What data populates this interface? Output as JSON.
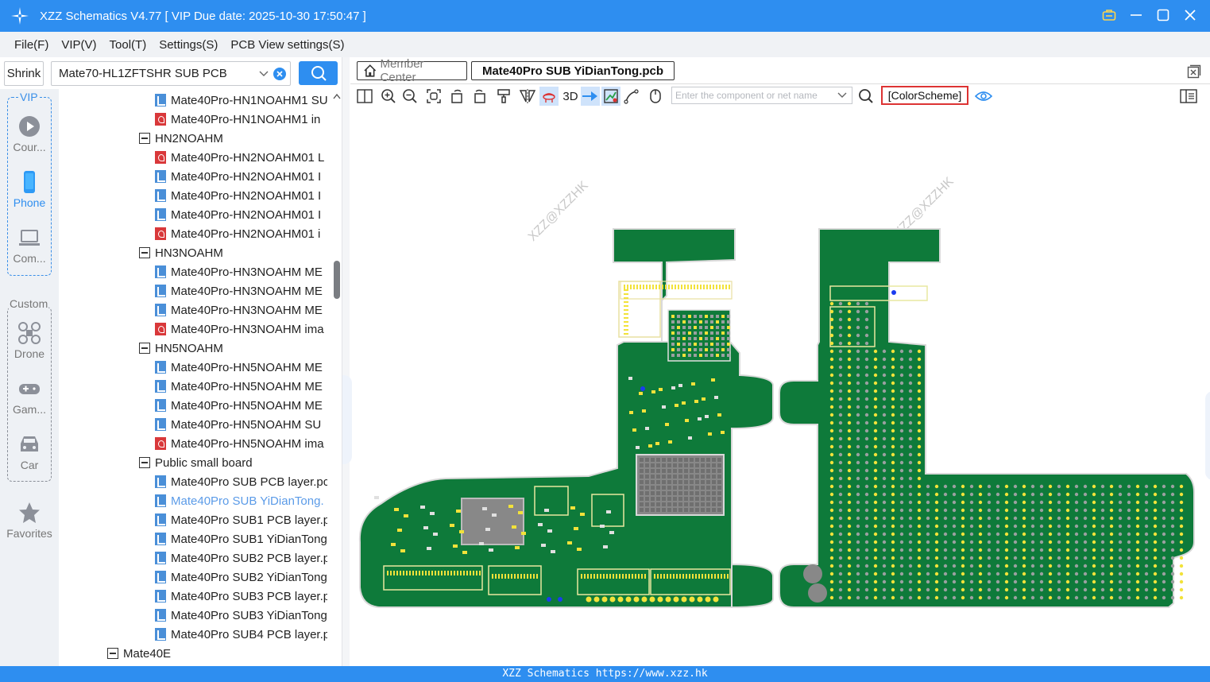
{
  "window": {
    "title": "XZZ Schematics V4.77 [ VIP Due date: 2025-10-30 17:50:47 ]"
  },
  "menu": [
    "File(F)",
    "VIP(V)",
    "Tool(T)",
    "Settings(S)",
    "PCB View settings(S)"
  ],
  "left": {
    "shrink_label": "Shrink",
    "model_value": "Mate70-HL1ZFTSHR SUB PCB",
    "categories": {
      "vip_label": "VIP",
      "custom_label": "Custom",
      "items": [
        "Cour...",
        "Phone",
        "Com...",
        "Drone",
        "Gam...",
        "Car"
      ],
      "favorites": "Favorites"
    },
    "tree": [
      {
        "type": "pcb",
        "text": "Mate40Pro-HN1NOAHM1 SU"
      },
      {
        "type": "pdf",
        "text": "Mate40Pro-HN1NOAHM1 in"
      },
      {
        "type": "group",
        "text": "HN2NOAHM"
      },
      {
        "type": "pdf",
        "text": "Mate40Pro-HN2NOAHM01 L"
      },
      {
        "type": "pcb",
        "text": "Mate40Pro-HN2NOAHM01 I"
      },
      {
        "type": "pcb",
        "text": "Mate40Pro-HN2NOAHM01 I"
      },
      {
        "type": "pcb",
        "text": "Mate40Pro-HN2NOAHM01 I"
      },
      {
        "type": "pdf",
        "text": "Mate40Pro-HN2NOAHM01 i"
      },
      {
        "type": "group",
        "text": "HN3NOAHM"
      },
      {
        "type": "pcb",
        "text": "Mate40Pro-HN3NOAHM ME"
      },
      {
        "type": "pcb",
        "text": "Mate40Pro-HN3NOAHM ME"
      },
      {
        "type": "pcb",
        "text": "Mate40Pro-HN3NOAHM ME"
      },
      {
        "type": "pdf",
        "text": "Mate40Pro-HN3NOAHM ima"
      },
      {
        "type": "group",
        "text": "HN5NOAHM"
      },
      {
        "type": "pcb",
        "text": "Mate40Pro-HN5NOAHM ME"
      },
      {
        "type": "pcb",
        "text": "Mate40Pro-HN5NOAHM ME"
      },
      {
        "type": "pcb",
        "text": "Mate40Pro-HN5NOAHM ME"
      },
      {
        "type": "pcb",
        "text": "Mate40Pro-HN5NOAHM SU"
      },
      {
        "type": "pdf",
        "text": "Mate40Pro-HN5NOAHM ima"
      },
      {
        "type": "group",
        "text": "Public small board"
      },
      {
        "type": "pcb",
        "text": "Mate40Pro SUB PCB layer.pc"
      },
      {
        "type": "pcb",
        "text": "Mate40Pro SUB YiDianTong.",
        "selected": true
      },
      {
        "type": "pcb",
        "text": "Mate40Pro SUB1 PCB layer.p"
      },
      {
        "type": "pcb",
        "text": "Mate40Pro SUB1 YiDianTong"
      },
      {
        "type": "pcb",
        "text": "Mate40Pro SUB2 PCB layer.p"
      },
      {
        "type": "pcb",
        "text": "Mate40Pro SUB2 YiDianTong"
      },
      {
        "type": "pcb",
        "text": "Mate40Pro SUB3 PCB layer.p"
      },
      {
        "type": "pcb",
        "text": "Mate40Pro SUB3 YiDianTong"
      },
      {
        "type": "pcb",
        "text": "Mate40Pro SUB4 PCB layer.p"
      },
      {
        "type": "group_top",
        "text": "Mate40E"
      }
    ]
  },
  "main": {
    "tabs": {
      "member": "Member Center",
      "active": "Mate40Pro SUB YiDianTong.pcb"
    },
    "tool_3d_label": "3D",
    "component_placeholder": "Enter the component or net name",
    "color_scheme_label": "[ColorScheme]",
    "watermark": "XZZ@XZZHK"
  },
  "status": {
    "text": "XZZ Schematics https://www.xzz.hk"
  },
  "colors": {
    "accent": "#2e8ef0",
    "pcb_green": "#0e7a3a",
    "pad_yellow": "#f2e23a",
    "selected_text": "#5b9be8"
  }
}
